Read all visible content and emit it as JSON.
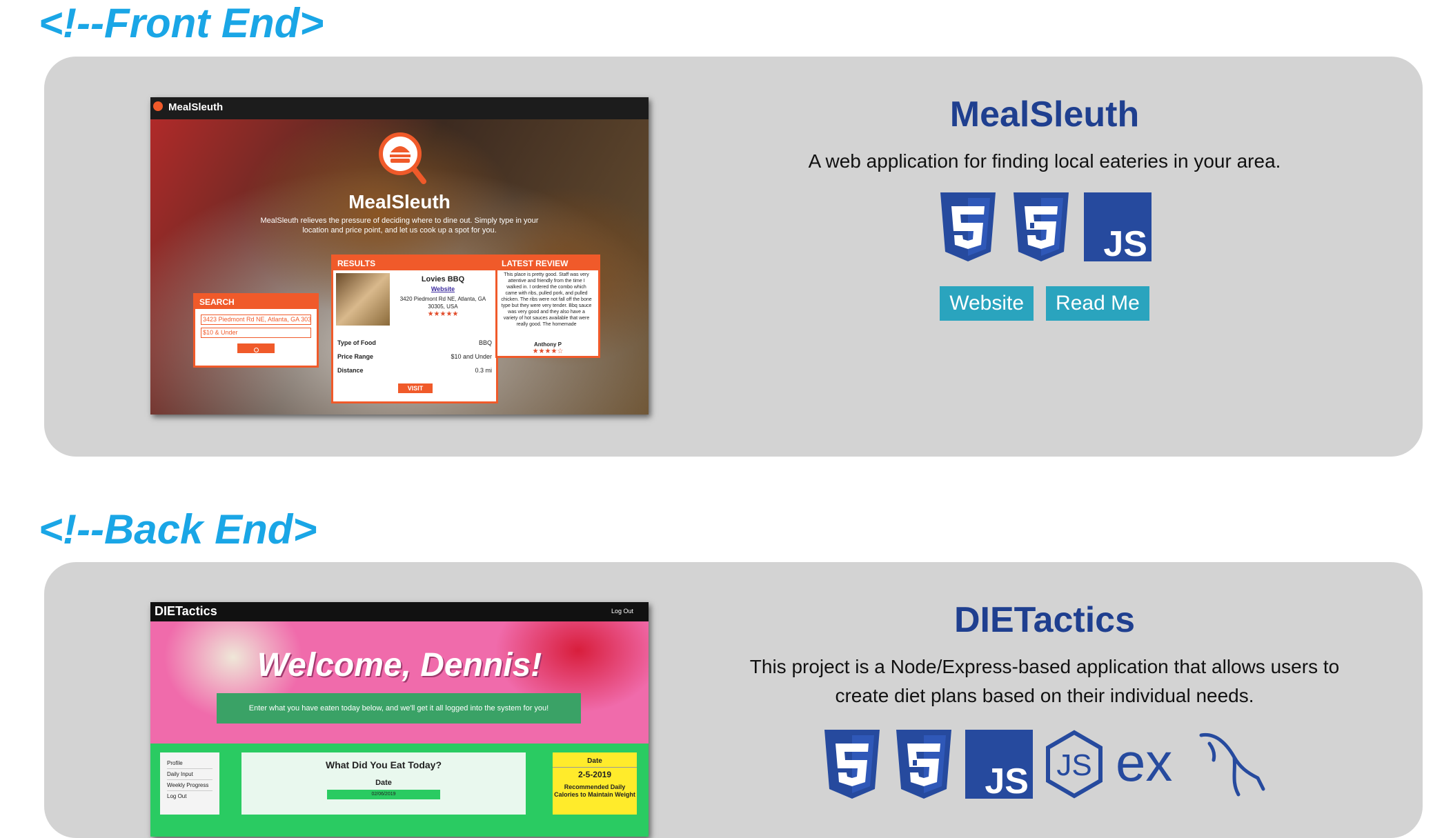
{
  "sections": [
    {
      "heading": "<!--Front End>",
      "project": {
        "title": "MealSleuth",
        "description": "A web application for finding local eateries in your area.",
        "tech_icons": [
          "html5-icon",
          "css3-icon",
          "javascript-icon"
        ],
        "buttons": {
          "website": "Website",
          "readme": "Read Me"
        },
        "screenshot": {
          "brand": "MealSleuth",
          "hero_title": "MealSleuth",
          "tagline": "MealSleuth relieves the pressure of deciding where to dine out. Simply type in your location and price point, and let us cook up a spot for you.",
          "search": {
            "heading": "SEARCH",
            "location_value": "3423 Piedmont Rd NE, Atlanta, GA 303",
            "price_value": "$10 & Under"
          },
          "results": {
            "heading": "RESULTS",
            "name": "Lovies BBQ",
            "link": "Website",
            "address": "3420 Piedmont Rd NE, Atlanta, GA 30305, USA",
            "rows": [
              {
                "label": "Type of Food",
                "value": "BBQ"
              },
              {
                "label": "Price Range",
                "value": "$10 and Under"
              },
              {
                "label": "Distance",
                "value": "0.3 mi"
              }
            ],
            "visit": "VISIT"
          },
          "review": {
            "heading": "LATEST REVIEW",
            "text": "This place is pretty good. Staff was very attentive and friendly from the time I walked in. I ordered the combo which came with ribs, pulled pork, and pulled chicken. The ribs were not fall off the bone type but they were very tender. Bbq sauce was very good and they also have a variety of hot sauces available that were really good. The homemade",
            "author": "Anthony P"
          }
        }
      }
    },
    {
      "heading": "<!--Back End>",
      "project": {
        "title": "DIETactics",
        "description": "This project is a Node/Express-based application that allows users to create diet plans based on their individual needs.",
        "tech_icons": [
          "html5-icon",
          "css3-icon",
          "javascript-icon",
          "nodejs-icon",
          "express-icon",
          "mysql-icon"
        ],
        "screenshot": {
          "brand": "DIETactics",
          "logout": "Log Out",
          "welcome": "Welcome, Dennis!",
          "banner": "Enter what you have eaten today below, and we'll get it all logged into the system for you!",
          "nav": [
            "Profile",
            "Daily Input",
            "Weekly Progress",
            "Log Out"
          ],
          "form_title": "What Did You Eat Today?",
          "form_date_label": "Date",
          "form_date_value": "02/06/2019",
          "side_date_label": "Date",
          "side_date_value": "2-5-2019",
          "side_note": "Recommended Daily Calories to Maintain Weight"
        }
      }
    }
  ],
  "colors": {
    "heading": "#1aa6e6",
    "card": "#d3d3d3",
    "title": "#1f3f8f",
    "button": "#2aa4be",
    "icon": "#264a9e"
  }
}
